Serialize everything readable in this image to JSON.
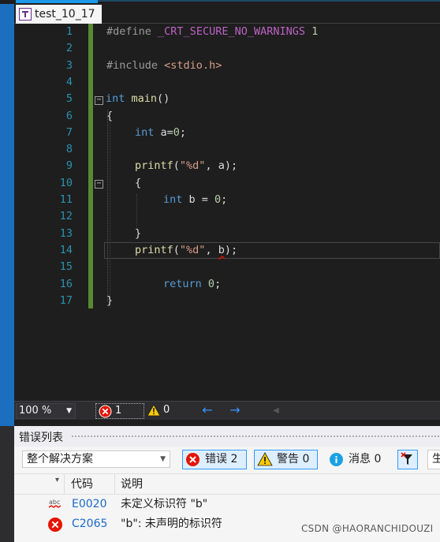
{
  "tab": {
    "title": "test_10_17"
  },
  "editor": {
    "line_numbers": [
      "1",
      "2",
      "3",
      "4",
      "5",
      "6",
      "7",
      "8",
      "9",
      "10",
      "11",
      "12",
      "13",
      "14",
      "15",
      "16",
      "17"
    ],
    "lines": [
      "#define _CRT_SECURE_NO_WARNINGS 1",
      "",
      "#include <stdio.h>",
      "",
      "int main()",
      "{",
      "    int a=0;",
      "",
      "    printf(\"%d\", a);",
      "    {",
      "        int b = 0;",
      "",
      "    }",
      "    printf(\"%d\", b);",
      "",
      "        return 0;",
      "}"
    ],
    "tokens": {
      "l1_pp": "#define",
      "l1_macro": "_CRT_SECURE_NO_WARNINGS",
      "l1_num": "1",
      "l3_pp": "#include",
      "l3_inc": "<stdio.h>",
      "l5_kw": "int",
      "l5_fn": "main",
      "l5_rest": "()",
      "l6": "{",
      "l7_kw": "int",
      "l7_rest1": " a=",
      "l7_num": "0",
      "l7_rest2": ";",
      "l9_fn": "printf",
      "l9_p1": "(",
      "l9_str": "\"%d\"",
      "l9_p2": ", a);",
      "l10": "{",
      "l11_kw": "int",
      "l11_rest": " b = ",
      "l11_num": "0",
      "l11_semi": ";",
      "l13": "}",
      "l14_fn": "printf",
      "l14_p1": "(",
      "l14_str": "\"%d\"",
      "l14_p2": ", ",
      "l14_b": "b",
      "l14_p3": ");",
      "l16_kw": "return",
      "l16_sp": " ",
      "l16_num": "0",
      "l16_semi": ";",
      "l17": "}"
    },
    "collapse_glyph": "−"
  },
  "status": {
    "zoom": "100 %",
    "error_count": "1",
    "warning_count": "0",
    "nav_back": "←",
    "nav_forward": "→",
    "nav_dim": "◀"
  },
  "error_list": {
    "title": "错误列表",
    "scope": "整个解决方案",
    "filters": {
      "errors": "错误 2",
      "warnings": "警告 0",
      "messages": "消息 0"
    },
    "build_button": "生",
    "columns": {
      "code": "代码",
      "description": "说明"
    },
    "rows": [
      {
        "icon": "abc-squiggle-icon",
        "code": "E0020",
        "description": "未定义标识符 \"b\""
      },
      {
        "icon": "error-icon",
        "code": "C2065",
        "description": "\"b\": 未声明的标识符"
      }
    ]
  },
  "watermark": "CSDN @HAORANCHIDOUZI",
  "colors": {
    "accent": "#1c97ea",
    "error": "#e51400",
    "warning": "#ffcc00",
    "info": "#1ba1e2",
    "line_number": "#2b91af"
  }
}
